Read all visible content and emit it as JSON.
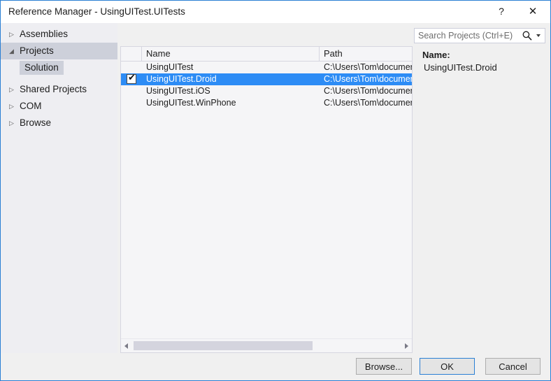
{
  "window": {
    "title": "Reference Manager - UsingUITest.UITests",
    "accent_color": "#2a7fd4",
    "selection_color": "#2d8cf5",
    "help_glyph": "?",
    "close_glyph": "✕"
  },
  "sidebar": {
    "items": [
      {
        "label": "Assemblies",
        "arrow": "▷",
        "expanded": false,
        "selected": false
      },
      {
        "label": "Projects",
        "arrow": "◢",
        "expanded": true,
        "selected": true
      },
      {
        "label": "Shared Projects",
        "arrow": "▷",
        "expanded": false,
        "selected": false
      },
      {
        "label": "COM",
        "arrow": "▷",
        "expanded": false,
        "selected": false
      },
      {
        "label": "Browse",
        "arrow": "▷",
        "expanded": false,
        "selected": false
      }
    ],
    "sub_items": [
      {
        "label": "Solution",
        "selected": true
      }
    ]
  },
  "search": {
    "value": "",
    "placeholder": "Search Projects (Ctrl+E)",
    "icon": "search-icon",
    "dropdown_icon": "chevron-down-icon"
  },
  "list": {
    "columns": [
      {
        "key": "check",
        "label": ""
      },
      {
        "key": "name",
        "label": "Name"
      },
      {
        "key": "path",
        "label": "Path"
      }
    ],
    "rows": [
      {
        "name": "UsingUITest",
        "path": "C:\\Users\\Tom\\document",
        "checked": false,
        "selected": false
      },
      {
        "name": "UsingUITest.Droid",
        "path": "C:\\Users\\Tom\\document",
        "checked": true,
        "selected": true
      },
      {
        "name": "UsingUITest.iOS",
        "path": "C:\\Users\\Tom\\document",
        "checked": false,
        "selected": false
      },
      {
        "name": "UsingUITest.WinPhone",
        "path": "C:\\Users\\Tom\\document",
        "checked": false,
        "selected": false
      }
    ],
    "checkbox_mark": "✔"
  },
  "detail": {
    "name_label": "Name:",
    "name_value": "UsingUITest.Droid"
  },
  "footer": {
    "browse_label": "Browse...",
    "ok_label": "OK",
    "cancel_label": "Cancel"
  }
}
